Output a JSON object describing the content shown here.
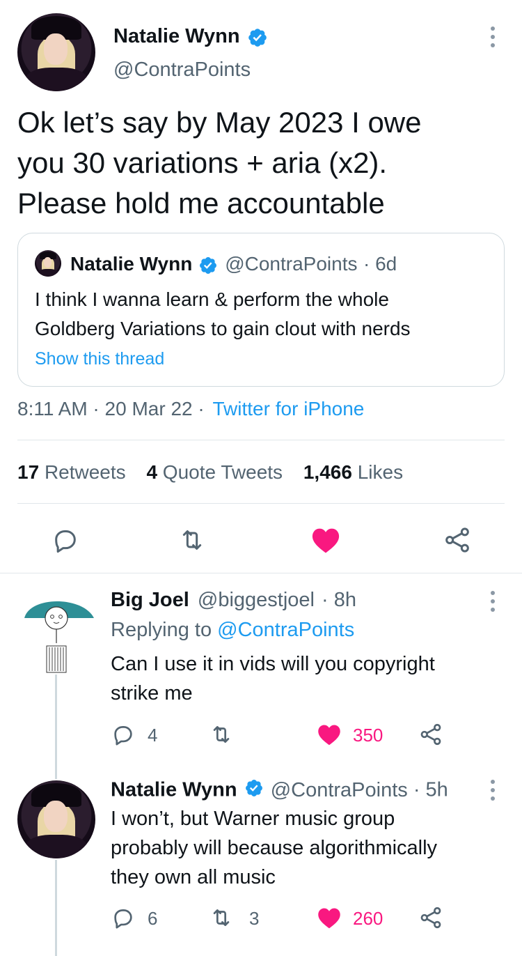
{
  "main_tweet": {
    "author_name": "Natalie Wynn",
    "author_handle": "@ContraPoints",
    "text_lines": [
      "Ok let’s say by May 2023 I owe",
      "you 30 variations + aria (x2).",
      "Please hold me accountable"
    ],
    "meta_time": "8:11 AM · 20 Mar 22 ·",
    "meta_source": "Twitter for iPhone"
  },
  "quoted_tweet": {
    "author_name": "Natalie Wynn",
    "author_handle": "@ContraPoints",
    "age": "· 6d",
    "text_lines": [
      "I think I wanna learn & perform the whole",
      "Goldberg Variations to gain clout with nerds"
    ],
    "show_thread": "Show this thread"
  },
  "stats": {
    "retweets_count": "17",
    "retweets_label": "Retweets",
    "quotes_count": "4",
    "quotes_label": "Quote Tweets",
    "likes_count": "1,466",
    "likes_label": "Likes"
  },
  "replies": [
    {
      "author_name": "Big Joel",
      "author_handle": "@biggestjoel",
      "age": "· 8h",
      "replying_prefix": "Replying to",
      "replying_to": "@ContraPoints",
      "text_lines": [
        "Can I use it in vids will you copyright",
        "strike me"
      ],
      "reply_count": "4",
      "retweet_count": "",
      "like_count": "350"
    },
    {
      "author_name": "Natalie Wynn",
      "author_handle": "@ContraPoints",
      "age": "· 5h",
      "text_lines": [
        "I won’t, but Warner music group",
        "probably will because algorithmically",
        "they own all music"
      ],
      "reply_count": "6",
      "retweet_count": "3",
      "like_count": "260"
    }
  ],
  "colors": {
    "accent_blue": "#1d9bf0",
    "like_pink": "#f91880",
    "text_primary": "#0f1419",
    "text_secondary": "#536471"
  },
  "icons": [
    "verified-badge-icon",
    "more-options-icon",
    "reply-icon",
    "retweet-icon",
    "like-icon",
    "share-icon"
  ]
}
